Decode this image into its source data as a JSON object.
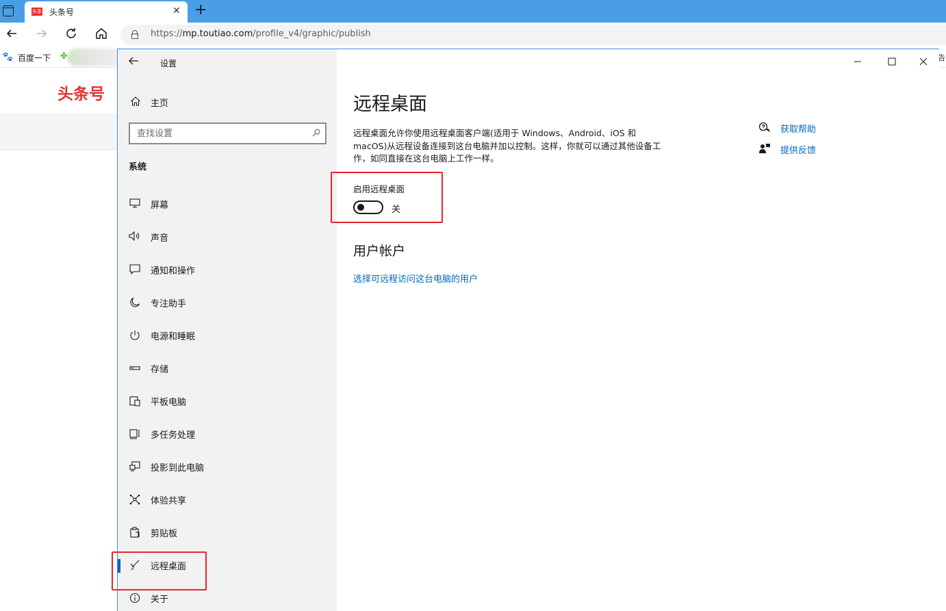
{
  "browser": {
    "tab": {
      "favicon_text": "头条",
      "title": "头条号",
      "close": "✕"
    },
    "new_tab": "+",
    "url": {
      "scheme": "https://",
      "host": "mp.toutiao.com",
      "path": "/profile_v4/graphic/publish"
    },
    "bookmarks": [
      {
        "label": "百度一下"
      }
    ],
    "bookmark_cutoff": "告"
  },
  "page": {
    "logo": "头条号"
  },
  "settings": {
    "window_title": "设置",
    "home_label": "主页",
    "search_placeholder": "查找设置",
    "section": "系统",
    "nav": [
      {
        "label": "屏幕",
        "icon": "monitor-icon"
      },
      {
        "label": "声音",
        "icon": "speaker-icon"
      },
      {
        "label": "通知和操作",
        "icon": "notification-icon"
      },
      {
        "label": "专注助手",
        "icon": "moon-icon"
      },
      {
        "label": "电源和睡眠",
        "icon": "power-icon"
      },
      {
        "label": "存储",
        "icon": "storage-icon"
      },
      {
        "label": "平板电脑",
        "icon": "tablet-icon"
      },
      {
        "label": "多任务处理",
        "icon": "multitask-icon"
      },
      {
        "label": "投影到此电脑",
        "icon": "project-icon"
      },
      {
        "label": "体验共享",
        "icon": "share-icon"
      },
      {
        "label": "剪贴板",
        "icon": "clipboard-icon"
      },
      {
        "label": "远程桌面",
        "icon": "remote-desktop-icon",
        "active": true
      },
      {
        "label": "关于",
        "icon": "info-icon"
      }
    ],
    "main": {
      "title": "远程桌面",
      "description": "远程桌面允许你使用远程桌面客户端(适用于 Windows、Android、iOS 和 macOS)从远程设备连接到这台电脑并加以控制。这样，你就可以通过其他设备工作，如同直接在这台电脑上工作一样。",
      "toggle_label": "启用远程桌面",
      "toggle_state": "关",
      "toggle_on": false,
      "user_accounts_heading": "用户帐户",
      "select_users_link": "选择可远程访问这台电脑的用户",
      "help_link": "获取帮助",
      "feedback_link": "提供反馈"
    }
  },
  "colors": {
    "accent": "#0067c0",
    "highlight_box": "#e8242a",
    "browser_tabstrip": "#4a9ee6",
    "logo": "#e8312f"
  }
}
